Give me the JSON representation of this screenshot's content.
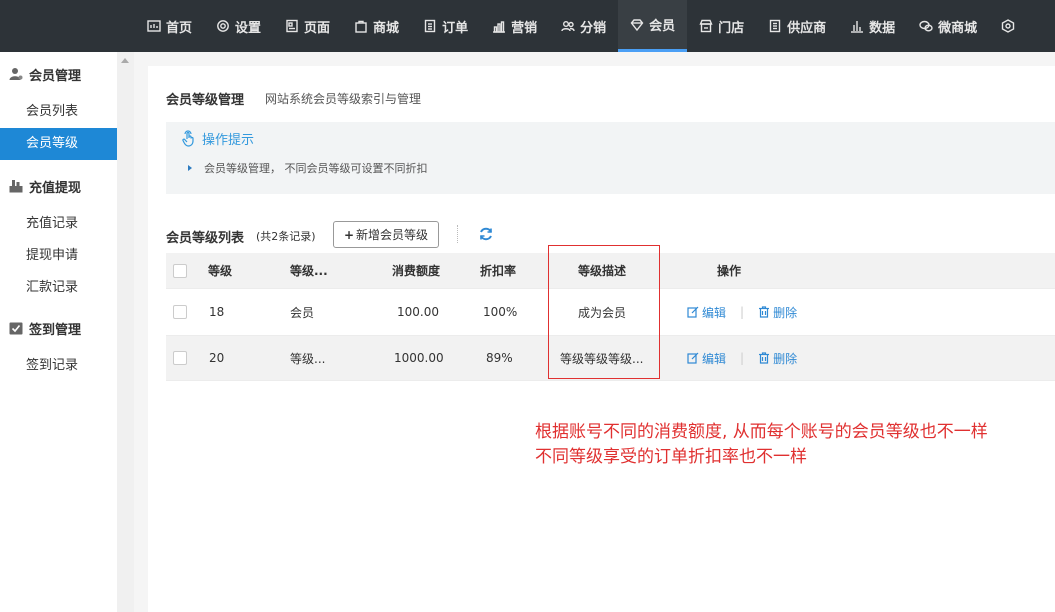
{
  "topnav": [
    {
      "label": "首页",
      "icon": "dashboard-icon"
    },
    {
      "label": "设置",
      "icon": "gear-icon"
    },
    {
      "label": "页面",
      "icon": "page-icon"
    },
    {
      "label": "商城",
      "icon": "bag-icon"
    },
    {
      "label": "订单",
      "icon": "order-icon"
    },
    {
      "label": "营销",
      "icon": "chart-icon"
    },
    {
      "label": "分销",
      "icon": "users-icon"
    },
    {
      "label": "会员",
      "icon": "diamond-icon",
      "active": true
    },
    {
      "label": "门店",
      "icon": "store-icon"
    },
    {
      "label": "供应商",
      "icon": "supplier-icon"
    },
    {
      "label": "数据",
      "icon": "bar-chart-icon"
    },
    {
      "label": "微商城",
      "icon": "wechat-icon"
    }
  ],
  "sidebar": {
    "groups": [
      {
        "label": "会员管理",
        "icon": "user-icon",
        "items": [
          "会员列表",
          "会员等级"
        ],
        "active": "会员等级"
      },
      {
        "label": "充值提现",
        "icon": "deposit-icon",
        "items": [
          "充值记录",
          "提现申请",
          "汇款记录"
        ]
      },
      {
        "label": "签到管理",
        "icon": "checkin-icon",
        "items": [
          "签到记录"
        ]
      }
    ]
  },
  "page": {
    "title": "会员等级管理",
    "subtitle": "网站系统会员等级索引与管理"
  },
  "tips": {
    "heading": "操作提示",
    "line": "会员等级管理， 不同会员等级可设置不同折扣"
  },
  "list": {
    "title": "会员等级列表",
    "count": "(共2条记录)",
    "add_button": "新增会员等级"
  },
  "table": {
    "headers": [
      "等级",
      "等级...",
      "消费额度",
      "折扣率",
      "等级描述",
      "操作"
    ],
    "rows": [
      {
        "level": "18",
        "name": "会员",
        "amount": "100.00",
        "discount": "100%",
        "desc": "成为会员"
      },
      {
        "level": "20",
        "name": "等级...",
        "amount": "1000.00",
        "discount": "89%",
        "desc": "等级等级等级..."
      }
    ],
    "edit_label": "编辑",
    "delete_label": "删除"
  },
  "annotation": {
    "line1": "根据账号不同的消费额度, 从而每个账号的会员等级也不一样",
    "line2": "不同等级享受的订单折扣率也不一样"
  },
  "colors": {
    "topbar": "#2d3338",
    "accent": "#1e88d6",
    "annotation": "#e03030"
  }
}
